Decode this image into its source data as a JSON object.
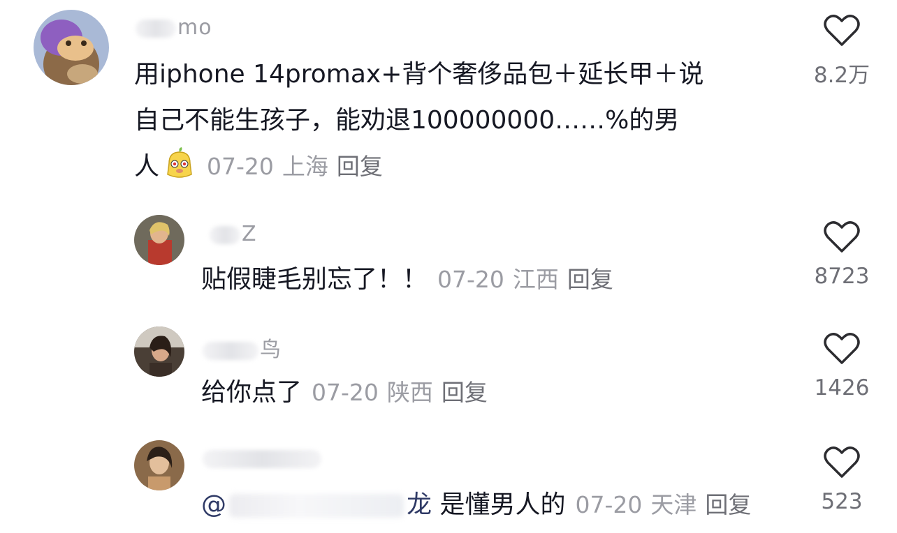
{
  "comments": [
    {
      "username": "mo",
      "text_lines": [
        "用iphone 14promax+背个奢侈品包＋延长甲＋说",
        "自己不能生孩子，能劝退100000000……%的男",
        "人"
      ],
      "date": "07-20",
      "location": "上海",
      "reply": "回复",
      "likes": "8.2万"
    },
    {
      "username": "Z",
      "text": "贴假睫毛别忘了！！",
      "date": "07-20",
      "location": "江西",
      "reply": "回复",
      "likes": "8723"
    },
    {
      "username": "鸟",
      "text": "给你点了",
      "date": "07-20",
      "location": "陕西",
      "reply": "回复",
      "likes": "1426"
    },
    {
      "username": "",
      "mention_prefix": "@",
      "mention_suffix": "龙",
      "text": "是懂男人的",
      "date": "07-20",
      "location": "天津",
      "reply": "回复",
      "likes": "523"
    }
  ],
  "icons": {
    "like": "heart-outline-icon",
    "emoji": "yellow-face-emoji-icon"
  },
  "colors": {
    "text": "#161823",
    "meta": "#9b9ca3",
    "like_count": "#6e6f76",
    "mention": "#2f3a66"
  }
}
